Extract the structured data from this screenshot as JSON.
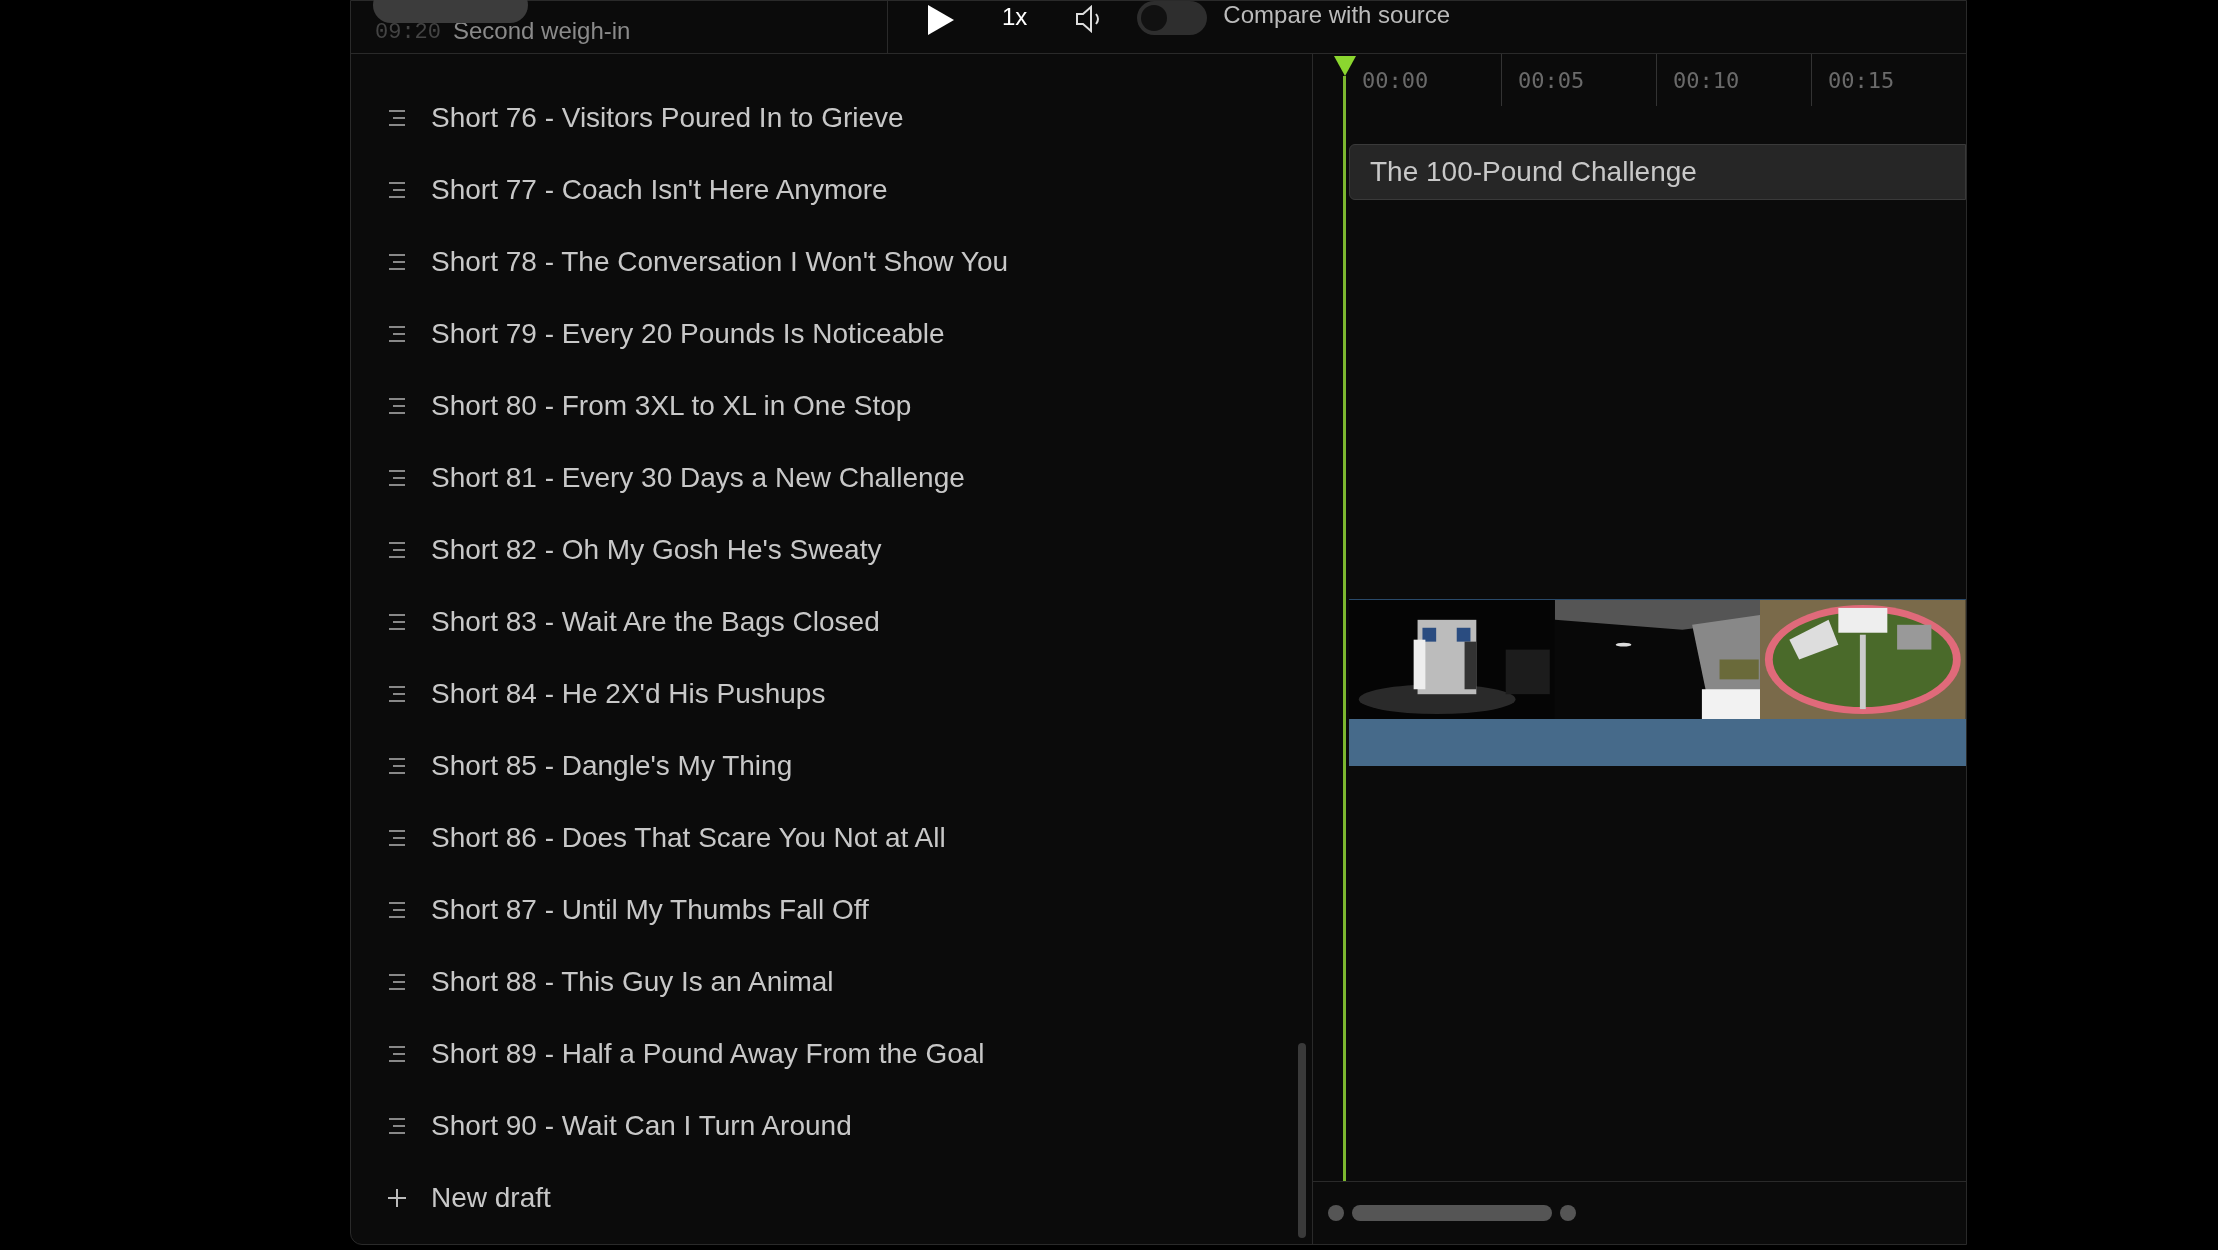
{
  "top_bar": {
    "chapter_time": "09:20",
    "chapter_title": "Second weigh-in",
    "speed": "1x",
    "compare_toggle": {
      "label": "Compare with source",
      "on": false
    }
  },
  "drafts": [
    {
      "title": "Short 76 - Visitors Poured In to Grieve"
    },
    {
      "title": "Short 77 - Coach Isn't Here Anymore"
    },
    {
      "title": "Short 78 - The Conversation I Won't Show You"
    },
    {
      "title": "Short 79 - Every 20 Pounds Is Noticeable"
    },
    {
      "title": "Short 80 - From 3XL to XL in One Stop"
    },
    {
      "title": "Short 81 - Every 30 Days a New Challenge"
    },
    {
      "title": "Short 82 - Oh My Gosh He's Sweaty"
    },
    {
      "title": "Short 83 - Wait Are the Bags Closed"
    },
    {
      "title": "Short 84 - He 2X'd His Pushups"
    },
    {
      "title": "Short 85 - Dangle's My Thing"
    },
    {
      "title": "Short 86 - Does That Scare You Not at All"
    },
    {
      "title": "Short 87 - Until My Thumbs Fall Off"
    },
    {
      "title": "Short 88 - This Guy Is an Animal"
    },
    {
      "title": "Short 89 - Half a Pound Away From the Goal"
    },
    {
      "title": "Short 90 - Wait Can I Turn Around"
    }
  ],
  "new_draft": "New draft",
  "timeline": {
    "ticks": [
      "00:00",
      "00:05",
      "00:10",
      "00:15"
    ],
    "title_clip": "The 100-Pound Challenge"
  }
}
